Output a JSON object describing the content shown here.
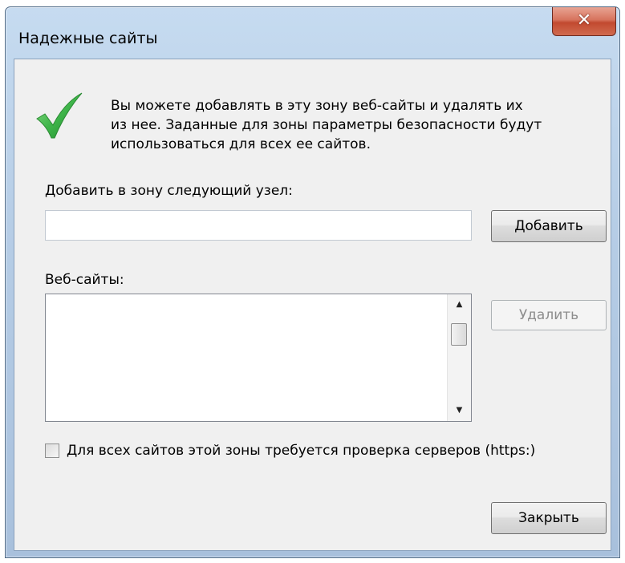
{
  "window": {
    "title": "Надежные сайты",
    "close_glyph": "✕"
  },
  "info": {
    "line1": "Вы можете добавлять в эту зону  веб-сайты и удалять их",
    "line2": "из нее. Заданные для зоны параметры безопасности будут",
    "line3": "использоваться для всех ее сайтов."
  },
  "add_site": {
    "label": "Добавить в зону следующий узел:",
    "value": "",
    "button_label": "Добавить"
  },
  "websites": {
    "label": "Веб-сайты:",
    "items": [],
    "remove_label": "Удалить"
  },
  "https_option": {
    "label": "Для всех сайтов этой зоны требуется проверка серверов (https:)",
    "checked": false
  },
  "footer": {
    "close_label": "Закрыть"
  },
  "icons": {
    "status": "green-checkmark-icon",
    "close": "close-icon"
  },
  "colors": {
    "checkmark": "#3fb54a",
    "close_button": "#c9553b"
  }
}
